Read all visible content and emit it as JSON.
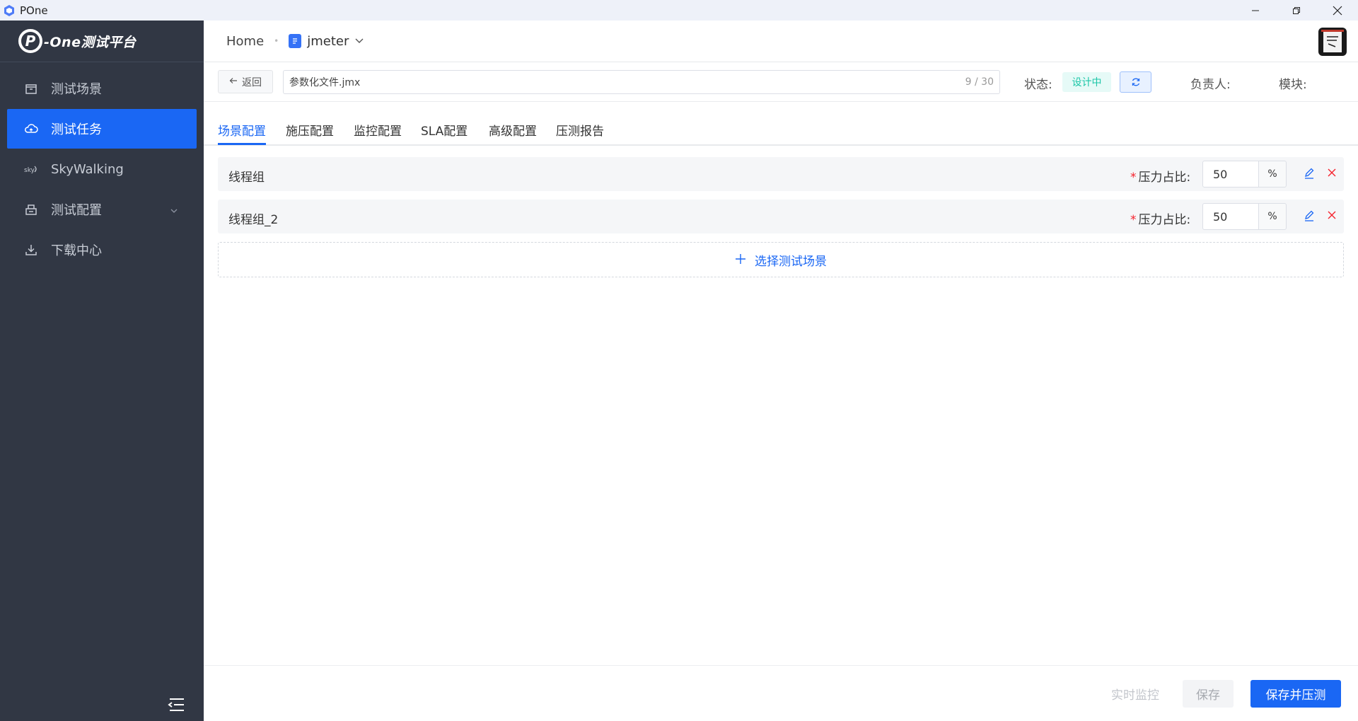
{
  "window": {
    "title": "POne",
    "icons": [
      "app-cube-icon",
      "minimize-icon",
      "restore-icon",
      "close-icon"
    ]
  },
  "sidebar": {
    "logo_mark": "P",
    "logo_text": "-One测试平台",
    "items": [
      {
        "label": "测试场景",
        "icon": "box-icon",
        "active": false
      },
      {
        "label": "测试任务",
        "icon": "cloud-icon",
        "active": true
      },
      {
        "label": "SkyWalking",
        "icon": "skywalking-icon",
        "active": false
      },
      {
        "label": "测试配置",
        "icon": "config-icon",
        "active": false,
        "has_submenu": true
      },
      {
        "label": "下载中心",
        "icon": "download-icon",
        "active": false
      }
    ]
  },
  "header": {
    "home": "Home",
    "current": "jmeter"
  },
  "toolbar": {
    "back_label": "返回",
    "file_name": "参数化文件.jmx",
    "file_count": "9 / 30",
    "status_label": "状态:",
    "status_value": "设计中",
    "owner_label": "负责人:",
    "module_label": "模块:"
  },
  "tabs": [
    "场景配置",
    "施压配置",
    "监控配置",
    "SLA配置",
    "高级配置",
    "压测报告"
  ],
  "active_tab": "场景配置",
  "thread_groups": [
    {
      "name": "线程组",
      "ratio_label": "压力占比:",
      "ratio": "50",
      "unit": "%"
    },
    {
      "name": "线程组_2",
      "ratio_label": "压力占比:",
      "ratio": "50",
      "unit": "%"
    }
  ],
  "required_mark": "*",
  "add_scene_label": "选择测试场景",
  "footer": {
    "monitor_label": "实时监控",
    "save_label": "保存",
    "save_run_label": "保存并压测"
  },
  "colors": {
    "primary": "#1a67f4",
    "sidebar_bg": "#313744",
    "status_text": "#1bc6a7",
    "status_bg": "#e6faf7",
    "danger": "#f5222d"
  }
}
